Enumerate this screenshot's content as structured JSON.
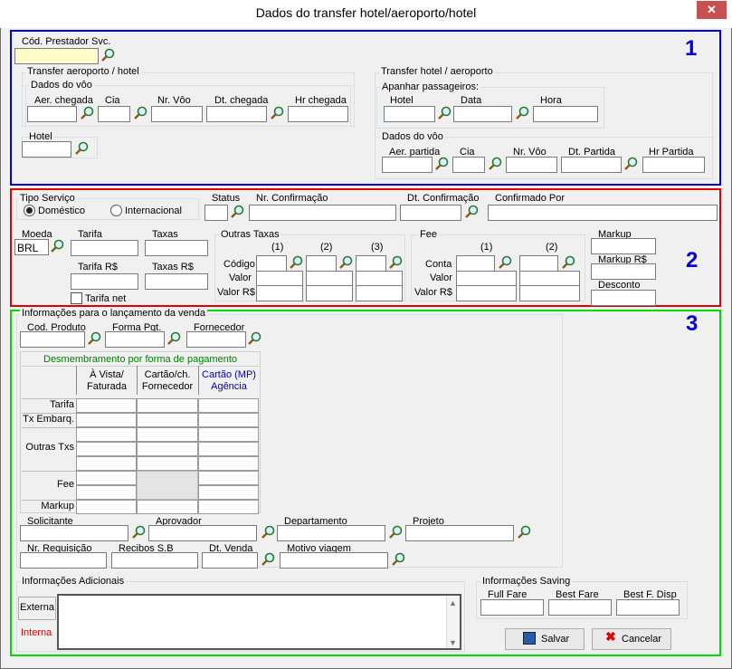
{
  "window": {
    "title": "Dados do transfer hotel/aeroporto/hotel",
    "close": "✕"
  },
  "sec1": {
    "num": "1",
    "cod_prestador": "Cód. Prestador Svc.",
    "transfer_ah": {
      "title": "Transfer aeroporto / hotel",
      "dados_voo": "Dados do vôo",
      "aer_chegada": "Aer. chegada",
      "cia": "Cia",
      "nr_voo": "Nr. Vôo",
      "dt_chegada": "Dt. chegada",
      "hr_chegada": "Hr chegada",
      "hotel": "Hotel"
    },
    "transfer_ha": {
      "title": "Transfer hotel / aeroporto",
      "apanhar": "Apanhar passageiros:",
      "hotel": "Hotel",
      "data": "Data",
      "hora": "Hora",
      "dados_voo": "Dados do vôo",
      "aer_partida": "Aer. partida",
      "cia": "Cia",
      "nr_voo": "Nr. Vôo",
      "dt_partida": "Dt. Partida",
      "hr_partida": "Hr Partida"
    }
  },
  "sec2": {
    "num": "2",
    "tipo_servico": "Tipo Serviço",
    "domestico": "Doméstico",
    "internacional": "Internacional",
    "status": "Status",
    "nr_confirmacao": "Nr. Confirmação",
    "dt_confirmacao": "Dt. Confirmação",
    "confirmado_por": "Confirmado Por",
    "moeda": "Moeda",
    "moeda_value": "BRL",
    "tarifa": "Tarifa",
    "taxas": "Taxas",
    "tarifa_rs": "Tarifa R$",
    "taxas_rs": "Taxas R$",
    "tarifa_net": "Tarifa net",
    "outras_taxas": "Outras Taxas",
    "c1": "(1)",
    "c2": "(2)",
    "c3": "(3)",
    "codigo": "Código",
    "valor": "Valor",
    "valor_rs": "Valor R$",
    "fee": "Fee",
    "f1": "(1)",
    "f2": "(2)",
    "conta": "Conta",
    "fvalor": "Valor",
    "fvalor_rs": "Valor R$",
    "markup": "Markup",
    "markup_rs": "Markup R$",
    "desconto": "Desconto"
  },
  "sec3": {
    "num": "3",
    "info_lanc": "Informações para o lançamento da venda",
    "cod_produto": "Cod. Produto",
    "forma_pgt": "Forma Pgt.",
    "fornecedor": "Fornecedor",
    "table": {
      "title": "Desmembramento por forma de pagamento",
      "col1": "À Vista/\nFaturada",
      "col2": "Cartão/ch.\nFornecedor",
      "col3": "Cartão (MP)\nAgência",
      "rows": [
        "Tarifa",
        "Tx Embarq.",
        "Outras Txs",
        "Fee",
        "Markup"
      ]
    },
    "solicitante": "Solicitante",
    "aprovador": "Aprovador",
    "departamento": "Departamento",
    "projeto": "Projeto",
    "nr_requisicao": "Nr. Requisição",
    "recibos": "Recibos S.B",
    "dt_venda": "Dt. Venda",
    "motivo": "Motivo viagem",
    "info_adicionais": "Informações Adicionais",
    "externa": "Externa",
    "interna": "Interna",
    "saving": "Informações Saving",
    "full_fare": "Full Fare",
    "best_fare": "Best Fare",
    "best_f_disp": "Best F. Disp",
    "salvar": "Salvar",
    "cancelar": "Cancelar"
  },
  "colors": {
    "sec1": "#0000e0",
    "sec2": "#e00000",
    "sec3": "#00dd00",
    "green_title": "#008000",
    "blue_col": "#0000c0",
    "interna": "#e00000"
  }
}
